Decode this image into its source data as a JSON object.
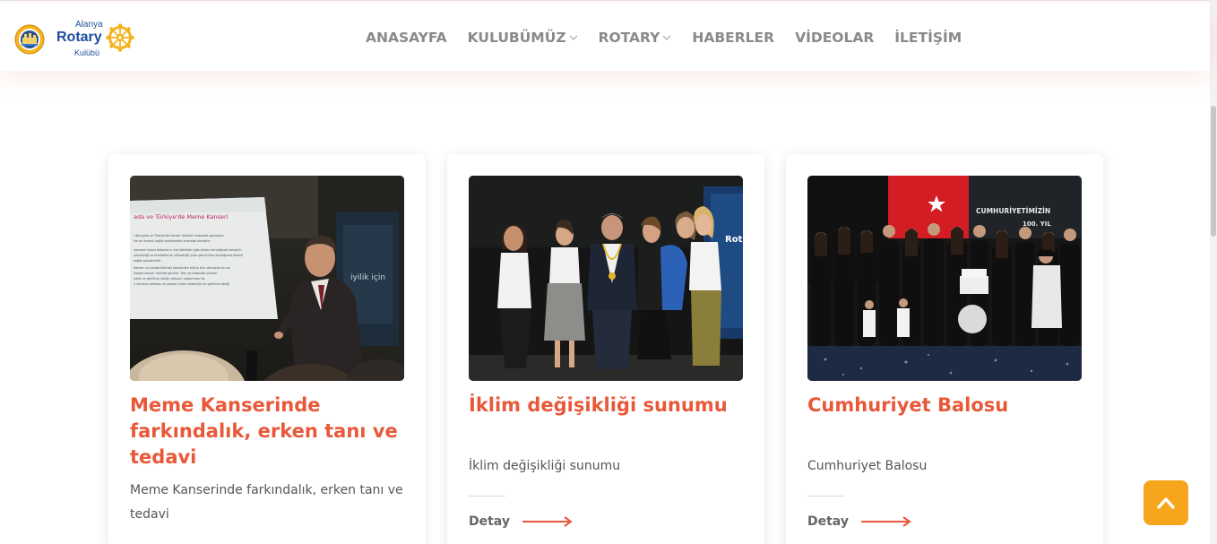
{
  "header": {
    "logo": {
      "line1": "Alanya",
      "line2": "Rotary",
      "line3": "Kulübü"
    },
    "menu": [
      {
        "label": "ANASAYFA",
        "has_dropdown": false
      },
      {
        "label": "KULUBÜMÜZ",
        "has_dropdown": true
      },
      {
        "label": "ROTARY",
        "has_dropdown": true
      },
      {
        "label": "HABERLER",
        "has_dropdown": false
      },
      {
        "label": "VİDEOLAR",
        "has_dropdown": false
      },
      {
        "label": "İLETİŞİM",
        "has_dropdown": false
      }
    ]
  },
  "posts": [
    {
      "title": "Meme Kanserinde farkındalık, erken tanı ve tedavi",
      "excerpt": "Meme Kanserinde farkındalık, erken tanı ve tedavi",
      "detail_label": "Detay",
      "image": {
        "slide_heading": "ada ve Türkiye'de Meme Kanseri",
        "slide_lines": [
          "ı dünyada ve Türkiye'de kanser ölümleri arasında geçmişini",
          "kla en önemli sağlık problemleri arasında olmaktır.",
          "kansere maruz kalanların risk faktörleri göz önüne alındığında kanserin",
          "yüksekliği ve mortalitenin yüksekliği yıllar göz önüne alındığında önemli",
          "sağlık problemidir.",
          "Kanser ve yılında ölümler kanserden bütün tüm dünyada en sık",
          "ulaşan kanser halinde görülür. Tanı ve tedavide yüksek",
          "sıklık ve görülme sıklığı nüfusun yaşlanması ile",
          "y nüfusun artması ve yaşam nüfus nedeniyle ile görülme sıklığı"
        ],
        "banner_text": "iyilik için"
      }
    },
    {
      "title": "İklim değişikliği sunumu",
      "excerpt": "İklim değişikliği sunumu",
      "detail_label": "Detay",
      "image": {
        "banner_text": "Rot"
      }
    },
    {
      "title": "Cumhuriyet Balosu",
      "excerpt": "Cumhuriyet Balosu",
      "detail_label": "Detay",
      "image": {
        "screen_text": "CUMHURİYETİMİZİN",
        "screen_subtext": "100. YIL"
      }
    }
  ],
  "colors": {
    "accent": "#e8593a",
    "nav_text": "#8a8a8a",
    "back_to_top": "#f6a51d",
    "rotary_blue": "#1f4e9c",
    "rotary_gold": "#f5b21d"
  },
  "icons": {
    "dropdown": "chevron-down-icon",
    "detail_arrow": "arrow-right-icon",
    "back_to_top": "chevron-up-icon"
  }
}
